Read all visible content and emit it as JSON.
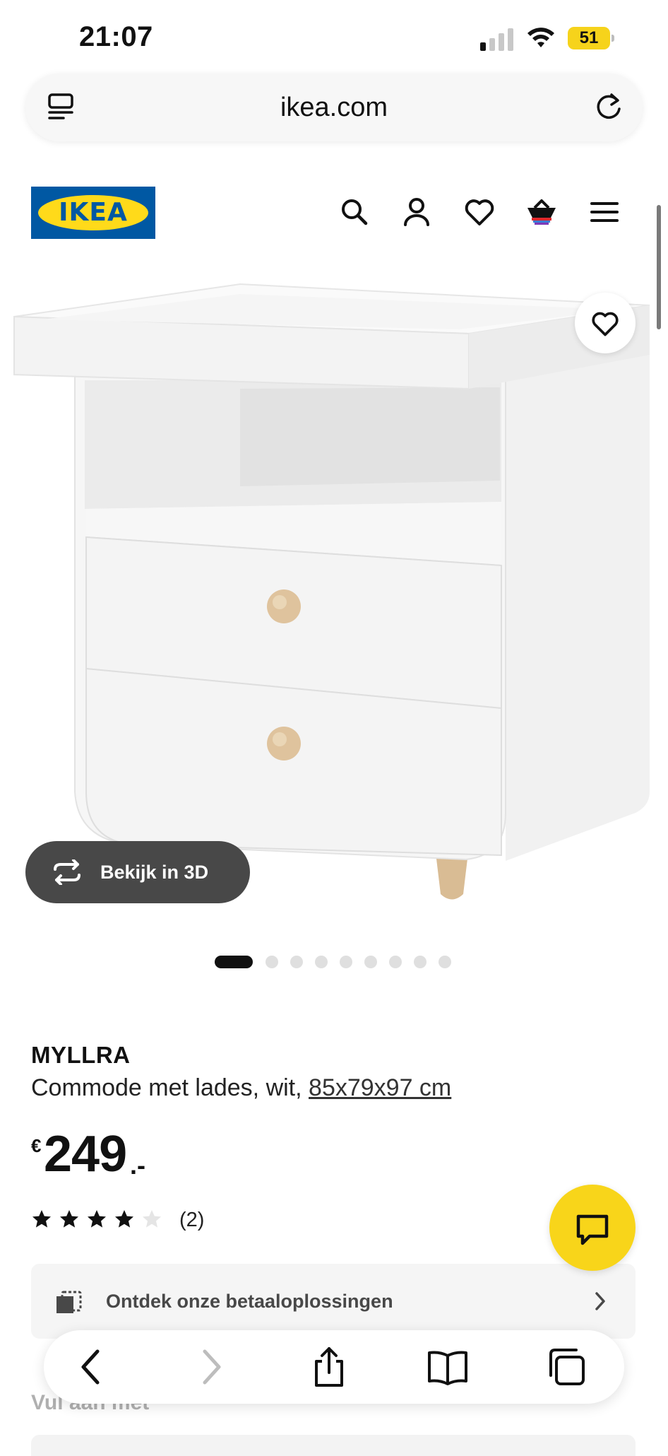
{
  "status_bar": {
    "time": "21:07",
    "battery_percent": "51",
    "signal_bars_active": 1,
    "signal_bars_total": 4
  },
  "browser": {
    "url": "ikea.com",
    "toolbar": {
      "back_icon": "chevron-left-icon",
      "forward_icon": "chevron-right-icon",
      "share_icon": "share-icon",
      "bookmarks_icon": "book-icon",
      "tabs_icon": "tabs-icon"
    }
  },
  "header": {
    "logo_text": "IKEA",
    "icons": [
      "search-icon",
      "account-icon",
      "heart-icon",
      "basket-icon",
      "menu-icon"
    ]
  },
  "product": {
    "view_3d_label": "Bekijk in 3D",
    "carousel": {
      "total": 9,
      "active_index": 0
    },
    "name": "MYLLRA",
    "description_prefix": "Commode met lades, wit, ",
    "dimensions": "85x79x97 cm",
    "price": {
      "currency": "€",
      "amount": "249",
      "decimal": ".-"
    },
    "rating": {
      "value": 4,
      "max": 5,
      "count": "(2)"
    },
    "payment_banner": "Ontdek onze betaaloplossingen",
    "next_section_heading": "Vul aan met"
  },
  "colors": {
    "ikea_blue": "#0058a3",
    "ikea_yellow": "#ffda1a",
    "chat_yellow": "#f8d51a",
    "button_dark": "#484848"
  }
}
